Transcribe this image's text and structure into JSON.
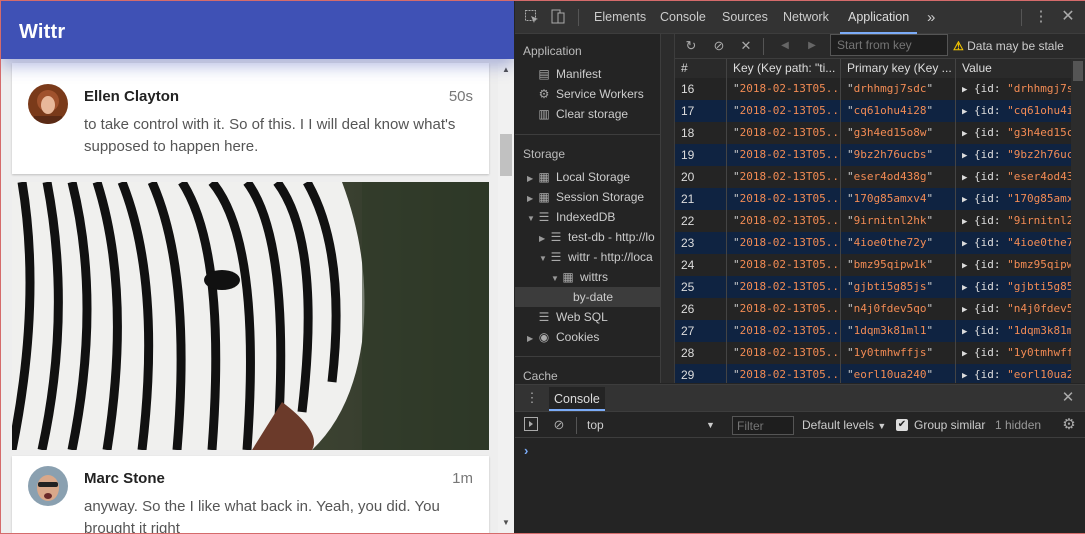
{
  "app": {
    "title": "Wittr",
    "posts": [
      {
        "author": "Ellen Clayton",
        "time": "50s",
        "text": "to take control with it. So of this. I I will deal know what's supposed to happen here."
      },
      {
        "author": "Marc Stone",
        "time": "1m",
        "text": "anyway. So the I like what back in. Yeah, you did. You brought it right"
      }
    ]
  },
  "devtools": {
    "tabs": [
      "Elements",
      "Console",
      "Sources",
      "Network",
      "Application"
    ],
    "active_tab": "Application",
    "more_tabs": "»",
    "sidebar": {
      "application_header": "Application",
      "application_items": [
        "Manifest",
        "Service Workers",
        "Clear storage"
      ],
      "storage_header": "Storage",
      "local_storage": "Local Storage",
      "session_storage": "Session Storage",
      "indexeddb": "IndexedDB",
      "test_db": "test-db - http://lo",
      "wittr_db": "wittr - http://loca",
      "store": "wittrs",
      "index": "by-date",
      "web_sql": "Web SQL",
      "cookies": "Cookies",
      "cache_header": "Cache"
    },
    "toolbar": {
      "start_key_placeholder": "Start from key",
      "stale_warning": "Data may be stale"
    },
    "grid": {
      "headers": [
        "#",
        "Key (Key path: \"ti...",
        "Primary key (Key ...",
        "Value"
      ],
      "rows": [
        {
          "n": "16",
          "key": "2018-02-13T05...",
          "pk": "drhhmgj7sdc",
          "val": "drhhmgj7s"
        },
        {
          "n": "17",
          "key": "2018-02-13T05...",
          "pk": "cq61ohu4i28",
          "val": "cq61ohu4i"
        },
        {
          "n": "18",
          "key": "2018-02-13T05...",
          "pk": "g3h4ed15o8w",
          "val": "g3h4ed15c"
        },
        {
          "n": "19",
          "key": "2018-02-13T05...",
          "pk": "9bz2h76ucbs",
          "val": "9bz2h76uc"
        },
        {
          "n": "20",
          "key": "2018-02-13T05...",
          "pk": "eser4od438g",
          "val": "eser4od43"
        },
        {
          "n": "21",
          "key": "2018-02-13T05...",
          "pk": "170g85amxv4",
          "val": "170g85amx"
        },
        {
          "n": "22",
          "key": "2018-02-13T05...",
          "pk": "9irnitnl2hk",
          "val": "9irnitnl2"
        },
        {
          "n": "23",
          "key": "2018-02-13T05...",
          "pk": "4ioe0the72y",
          "val": "4ioe0the7"
        },
        {
          "n": "24",
          "key": "2018-02-13T05...",
          "pk": "bmz95qipw1k",
          "val": "bmz95qipw"
        },
        {
          "n": "25",
          "key": "2018-02-13T05...",
          "pk": "gjbti5g85js",
          "val": "gjbti5g85"
        },
        {
          "n": "26",
          "key": "2018-02-13T05...",
          "pk": "n4j0fdev5qo",
          "val": "n4j0fdev5"
        },
        {
          "n": "27",
          "key": "2018-02-13T05...",
          "pk": "1dqm3k81ml1",
          "val": "1dqm3k81m"
        },
        {
          "n": "28",
          "key": "2018-02-13T05...",
          "pk": "1y0tmhwffjs",
          "val": "1y0tmhwff"
        },
        {
          "n": "29",
          "key": "2018-02-13T05...",
          "pk": "eorl10ua240",
          "val": "eorl10ua2"
        }
      ]
    },
    "drawer": {
      "tab": "Console",
      "context": "top",
      "filter_placeholder": "Filter",
      "levels": "Default levels",
      "group_similar": "Group similar",
      "hidden": "1 hidden",
      "prompt": "›"
    }
  }
}
